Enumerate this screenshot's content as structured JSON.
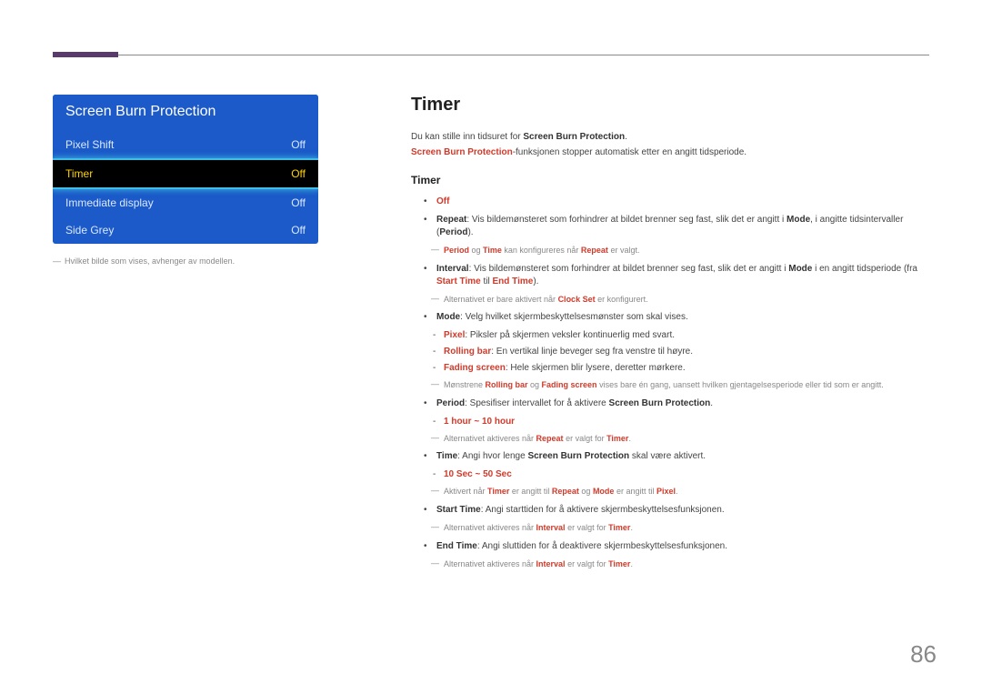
{
  "settings": {
    "title": "Screen Burn Protection",
    "rows": [
      {
        "label": "Pixel Shift",
        "value": "Off",
        "selected": false
      },
      {
        "label": "Timer",
        "value": "Off",
        "selected": true
      },
      {
        "label": "Immediate display",
        "value": "Off",
        "selected": false
      },
      {
        "label": "Side Grey",
        "value": "Off",
        "selected": false
      }
    ],
    "caption_prefix": "―",
    "caption": "Hvilket bilde som vises, avhenger av modellen."
  },
  "doc": {
    "h1": "Timer",
    "intro1_a": "Du kan stille inn tidsuret for ",
    "intro1_b": "Screen Burn Protection",
    "intro1_c": ".",
    "intro2_a": "Screen Burn Protection",
    "intro2_b": "-funksjonen stopper automatisk etter en angitt tidsperiode.",
    "h2": "Timer",
    "off": "Off",
    "repeat_label": "Repeat",
    "repeat_text": ": Vis bildemønsteret som forhindrer at bildet brenner seg fast, slik det er angitt i ",
    "repeat_mode": "Mode",
    "repeat_text2": ", i angitte tidsintervaller (",
    "repeat_period": "Period",
    "repeat_text3": ").",
    "repeat_note_a": "Period",
    "repeat_note_b": " og ",
    "repeat_note_c": "Time",
    "repeat_note_d": " kan konfigureres når ",
    "repeat_note_e": "Repeat",
    "repeat_note_f": " er valgt.",
    "interval_label": "Interval",
    "interval_text": ": Vis bildemønsteret som forhindrer at bildet brenner seg fast, slik det er angitt i ",
    "interval_mode": "Mode",
    "interval_text2": " i en angitt tidsperiode (fra ",
    "interval_start": "Start Time",
    "interval_til": " til ",
    "interval_end": "End Time",
    "interval_text3": ").",
    "interval_note_a": "Alternativet er bare aktivert når ",
    "interval_note_b": "Clock Set",
    "interval_note_c": " er konfigurert.",
    "mode_label": "Mode",
    "mode_text": ": Velg hvilket skjermbeskyttelsesmønster som skal vises.",
    "mode_pixel_label": "Pixel",
    "mode_pixel_text": ": Piksler på skjermen veksler kontinuerlig med svart.",
    "mode_rolling_label": "Rolling bar",
    "mode_rolling_text": ": En vertikal linje beveger seg fra venstre til høyre.",
    "mode_fading_label": "Fading screen",
    "mode_fading_text": ": Hele skjermen blir lysere, deretter mørkere.",
    "mode_note_a": "Mønstrene ",
    "mode_note_b": "Rolling bar",
    "mode_note_c": " og ",
    "mode_note_d": "Fading screen",
    "mode_note_e": " vises bare én gang, uansett hvilken gjentagelsesperiode eller tid som er angitt.",
    "period_label": "Period",
    "period_text": ": Spesifiser intervallet for å aktivere ",
    "period_sbp": "Screen Burn Protection",
    "period_text2": ".",
    "period_range": "1 hour ~ 10 hour",
    "period_note_a": "Alternativet aktiveres når ",
    "period_note_b": "Repeat",
    "period_note_c": " er valgt for ",
    "period_note_d": "Timer",
    "period_note_e": ".",
    "time_label": "Time",
    "time_text": ": Angi hvor lenge ",
    "time_sbp": "Screen Burn Protection",
    "time_text2": " skal være aktivert.",
    "time_range": "10 Sec ~ 50 Sec",
    "time_note_a": "Aktivert når ",
    "time_note_b": "Timer",
    "time_note_c": " er angitt til ",
    "time_note_d": "Repeat",
    "time_note_e": " og ",
    "time_note_f": "Mode",
    "time_note_g": " er angitt til ",
    "time_note_h": "Pixel",
    "time_note_i": ".",
    "start_label": "Start Time",
    "start_text": ": Angi starttiden for å aktivere skjermbeskyttelsesfunksjonen.",
    "start_note_a": "Alternativet aktiveres når ",
    "start_note_b": "Interval",
    "start_note_c": " er valgt for ",
    "start_note_d": "Timer",
    "start_note_e": ".",
    "end_label": "End Time",
    "end_text": ": Angi sluttiden for å deaktivere skjermbeskyttelsesfunksjonen.",
    "end_note_a": "Alternativet aktiveres når ",
    "end_note_b": "Interval",
    "end_note_c": " er valgt for ",
    "end_note_d": "Timer",
    "end_note_e": "."
  },
  "page_number": "86"
}
